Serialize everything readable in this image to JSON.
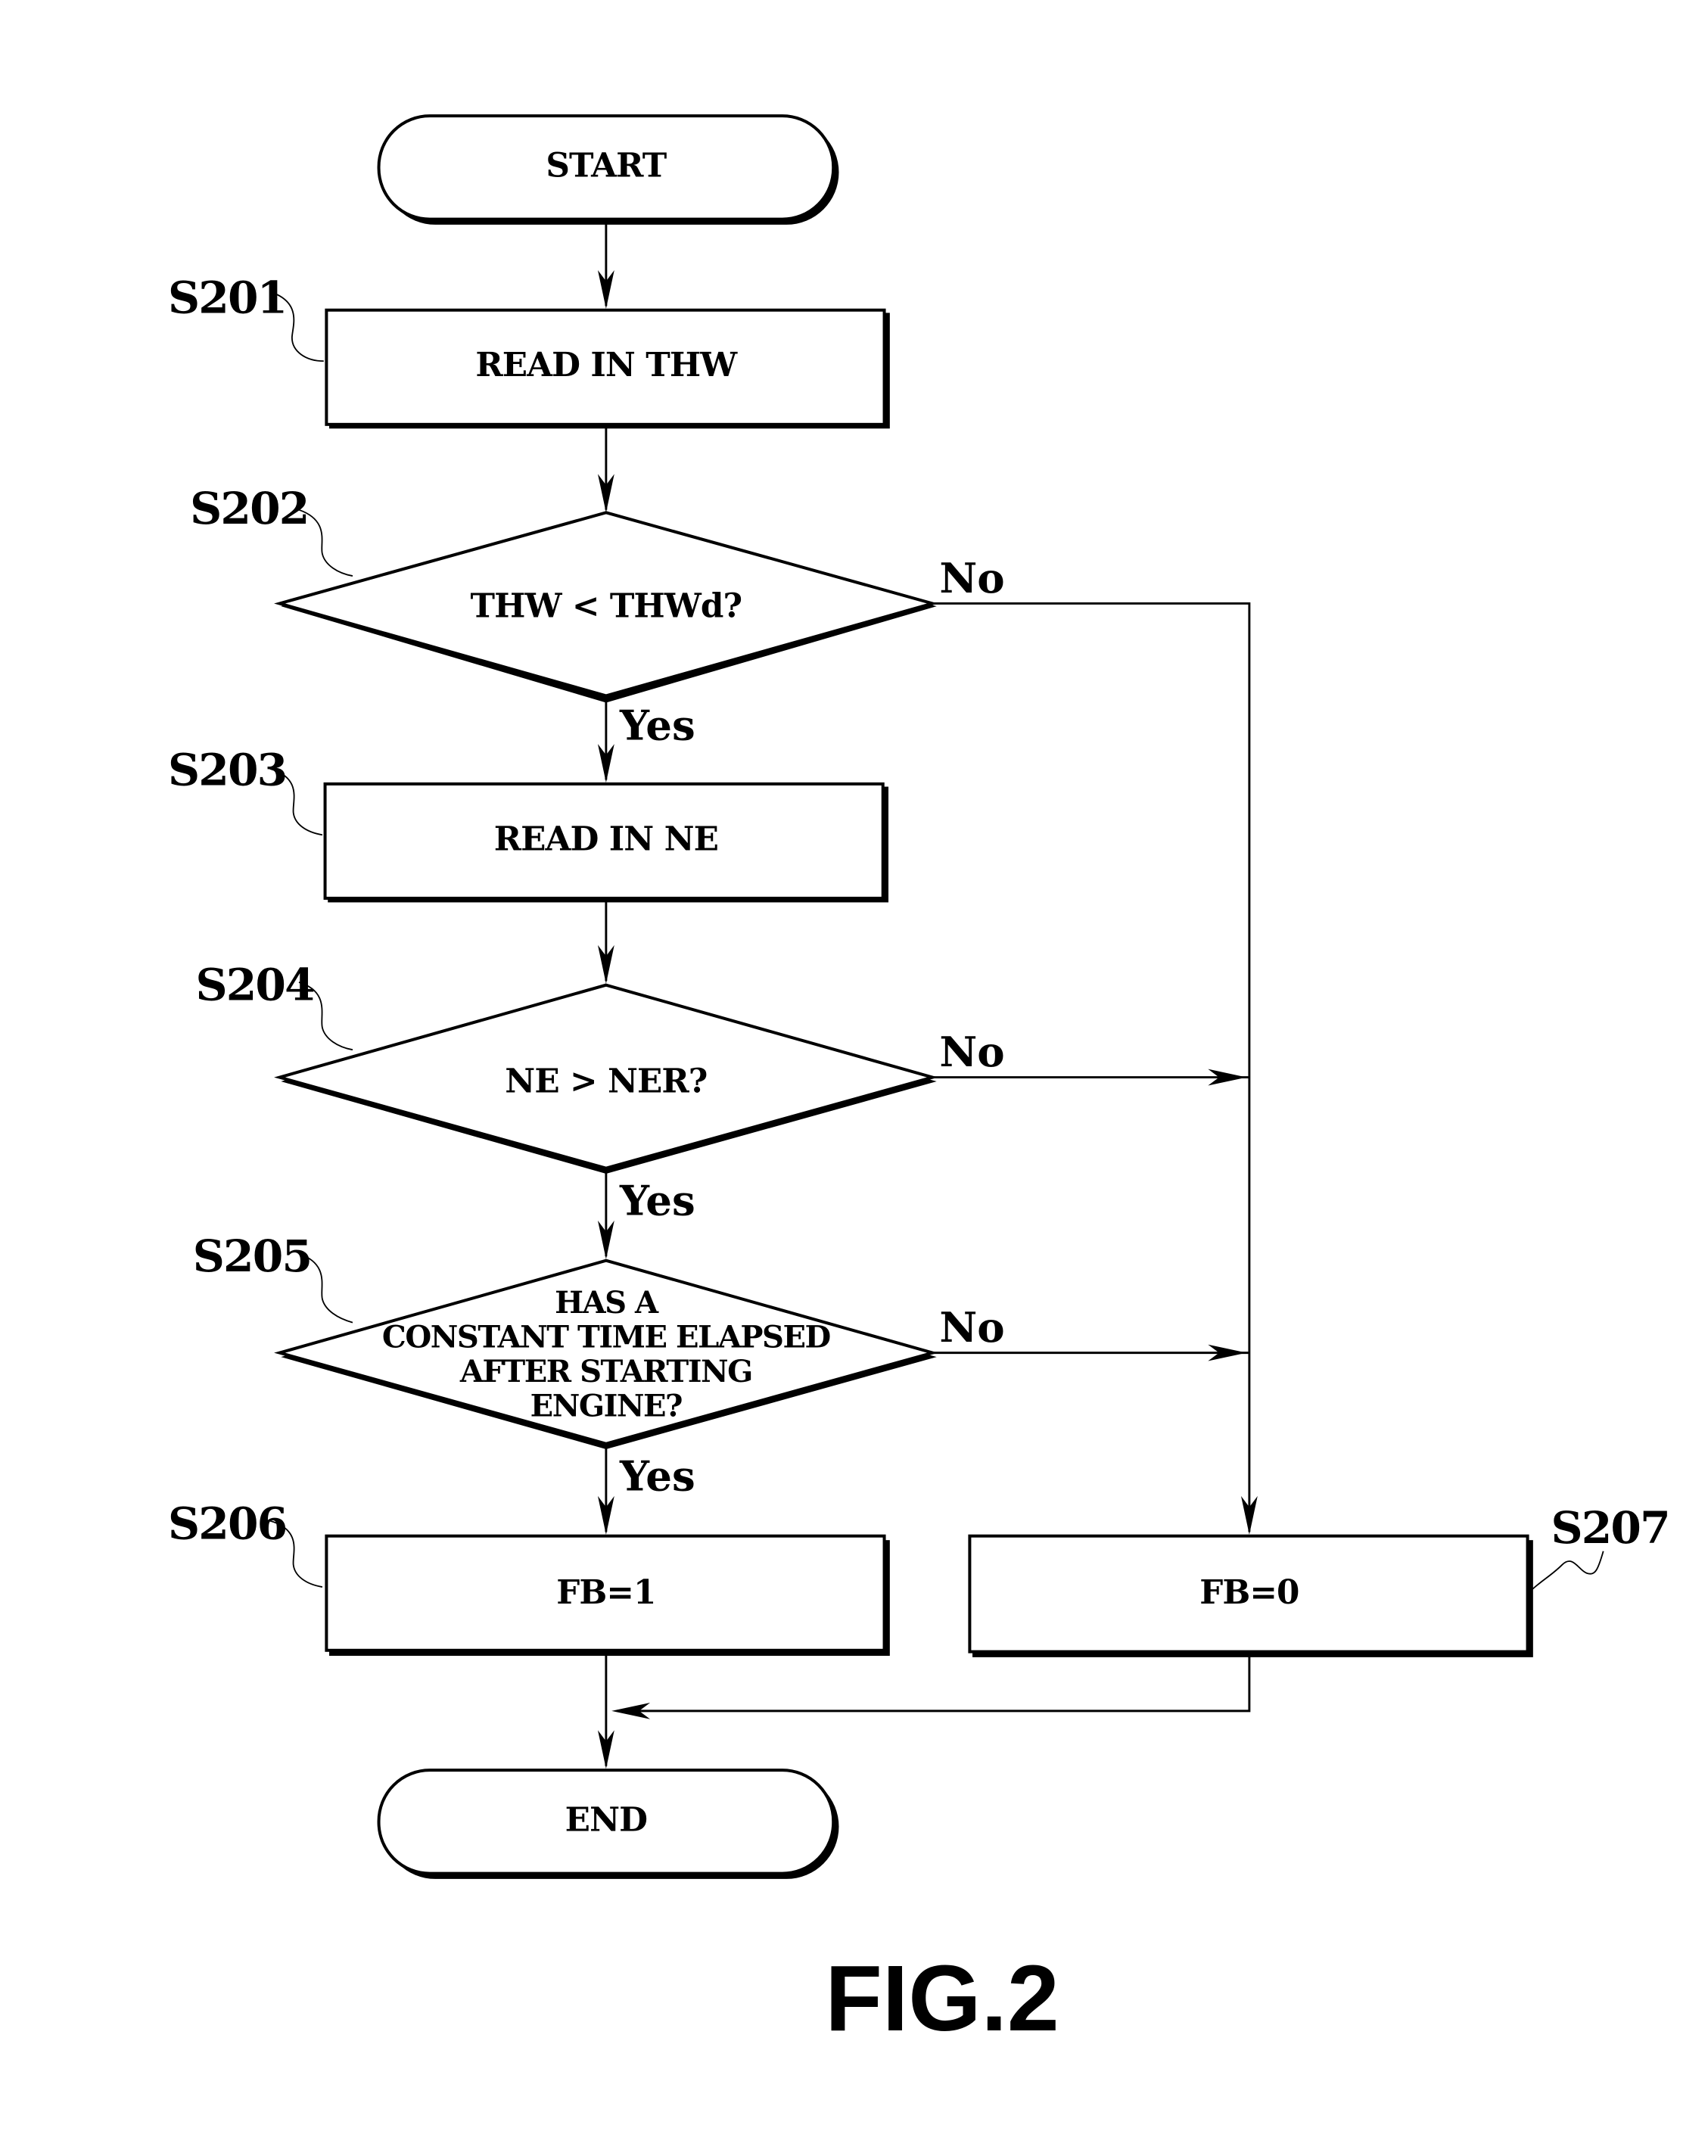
{
  "figure": {
    "caption": "FIG.2",
    "nodes": {
      "start": {
        "type": "terminal",
        "label": "START"
      },
      "s201": {
        "type": "process",
        "step": "S201",
        "label": "READ IN THW"
      },
      "s202": {
        "type": "decision",
        "step": "S202",
        "label": "THW < THWd?",
        "yes": "Yes",
        "no": "No"
      },
      "s203": {
        "type": "process",
        "step": "S203",
        "label": "READ IN NE"
      },
      "s204": {
        "type": "decision",
        "step": "S204",
        "label": "NE > NER?",
        "yes": "Yes",
        "no": "No"
      },
      "s205": {
        "type": "decision",
        "step": "S205",
        "lines": [
          "HAS A",
          "CONSTANT TIME ELAPSED",
          "AFTER STARTING",
          "ENGINE?"
        ],
        "yes": "Yes",
        "no": "No"
      },
      "s206": {
        "type": "process",
        "step": "S206",
        "label": "FB=1"
      },
      "s207": {
        "type": "process",
        "step": "S207",
        "label": "FB=0"
      },
      "end": {
        "type": "terminal",
        "label": "END"
      }
    },
    "edges": [
      {
        "from": "start",
        "to": "s201"
      },
      {
        "from": "s201",
        "to": "s202"
      },
      {
        "from": "s202",
        "to": "s203",
        "label": "Yes"
      },
      {
        "from": "s202",
        "to": "s207",
        "label": "No"
      },
      {
        "from": "s203",
        "to": "s204"
      },
      {
        "from": "s204",
        "to": "s205",
        "label": "Yes"
      },
      {
        "from": "s204",
        "to": "s207",
        "label": "No"
      },
      {
        "from": "s205",
        "to": "s206",
        "label": "Yes"
      },
      {
        "from": "s205",
        "to": "s207",
        "label": "No"
      },
      {
        "from": "s206",
        "to": "end"
      },
      {
        "from": "s207",
        "to": "end"
      }
    ]
  }
}
